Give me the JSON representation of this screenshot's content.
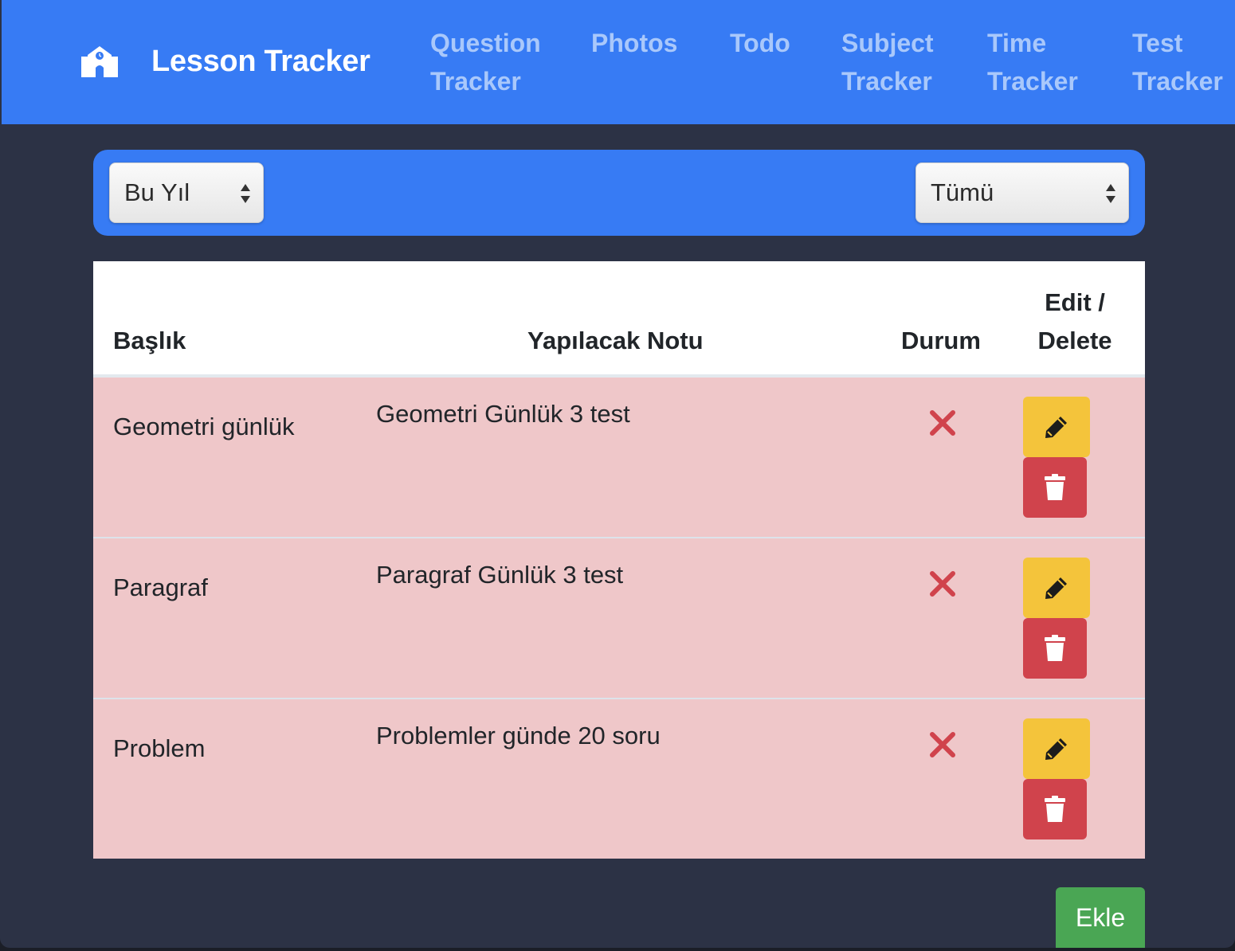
{
  "app": {
    "brand": "Lesson Tracker",
    "brand_icon": "school-icon"
  },
  "nav": {
    "items": [
      {
        "line1": "Question",
        "line2": "Tracker"
      },
      {
        "line1": "Photos",
        "line2": ""
      },
      {
        "line1": "Todo",
        "line2": ""
      },
      {
        "line1": "Subject",
        "line2": "Tracker"
      },
      {
        "line1": "Time",
        "line2": "Tracker"
      },
      {
        "line1": "Test",
        "line2": "Tracker"
      }
    ]
  },
  "filters": {
    "period": "Bu Yıl",
    "status": "Tümü"
  },
  "table": {
    "headers": {
      "title": "Başlık",
      "note": "Yapılacak Notu",
      "status": "Durum",
      "actions_line1": "Edit /",
      "actions_line2": "Delete"
    },
    "rows": [
      {
        "title": "Geometri günlük",
        "note": "Geometri Günlük 3 test",
        "status_icon": "x-icon"
      },
      {
        "title": "Paragraf",
        "note": "Paragraf Günlük 3 test",
        "status_icon": "x-icon"
      },
      {
        "title": "Problem",
        "note": "Problemler günde 20 soru",
        "status_icon": "x-icon"
      }
    ]
  },
  "actions": {
    "add_label": "Ekle"
  },
  "colors": {
    "primary": "#377bf4",
    "background": "#2c3245",
    "row_incomplete": "#efc7c9",
    "edit": "#f4c43b",
    "delete": "#d0434c",
    "add": "#4aa654",
    "status_x": "#d0434c"
  }
}
